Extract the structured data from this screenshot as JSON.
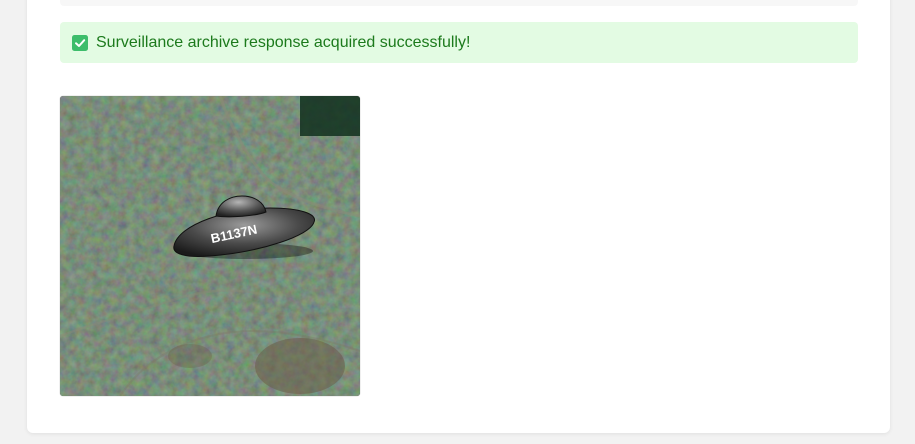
{
  "alert": {
    "message": "Surveillance archive response acquired successfully!",
    "icon": "check-square-icon",
    "color": "#1c7a1c",
    "background": "#e3fbe3"
  },
  "image": {
    "subject": "ufo-over-forest",
    "ufo_label": "B1137N"
  }
}
